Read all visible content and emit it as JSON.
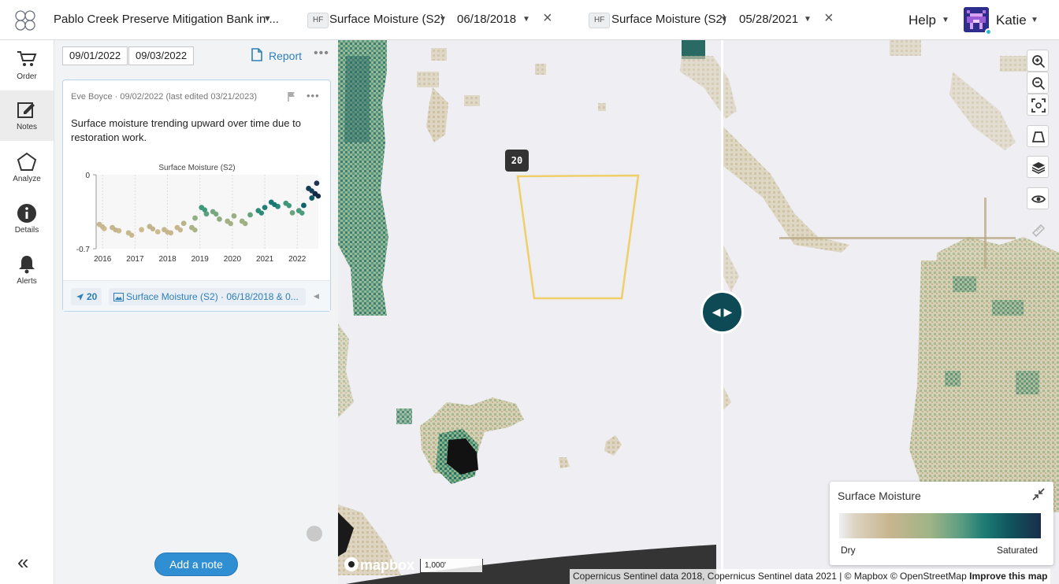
{
  "header": {
    "project": "Pablo Creek Preserve Mitigation Bank in ...",
    "left_layer": {
      "badge": "HF",
      "name": "Surface Moisture (S2)",
      "date": "06/18/2018"
    },
    "right_layer": {
      "badge": "HF",
      "name": "Surface Moisture (S2)",
      "date": "05/28/2021"
    },
    "help": "Help",
    "user": "Katie"
  },
  "rail": [
    {
      "label": "Order",
      "icon": "cart-icon"
    },
    {
      "label": "Notes",
      "icon": "notes-icon",
      "active": true
    },
    {
      "label": "Analyze",
      "icon": "pentagon-icon"
    },
    {
      "label": "Details",
      "icon": "info-icon"
    },
    {
      "label": "Alerts",
      "icon": "bell-icon"
    }
  ],
  "notes": {
    "date_from": "09/01/2022",
    "date_to": "09/03/2022",
    "report": "Report",
    "note": {
      "meta": "Eve Boyce · 09/02/2022 (last edited 03/21/2023)",
      "text": "Surface moisture trending upward over time due to restoration work.",
      "location_chip": "20",
      "layer_chip": "Surface Moisture (S2) · 06/18/2018 & 0..."
    },
    "add_note": "Add a note"
  },
  "chart_data": {
    "type": "scatter",
    "title": "Surface Moisture (S2)",
    "xlabel": "",
    "ylabel": "",
    "ylim": [
      -0.7,
      0
    ],
    "xlim": [
      2015.8,
      2022.65
    ],
    "yticks": [
      "0",
      "-0.7"
    ],
    "xticks": [
      "2016",
      "2017",
      "2018",
      "2019",
      "2020",
      "2021",
      "2022"
    ],
    "x": [
      2015.9,
      2016.05,
      2016.3,
      2016.5,
      2016.8,
      2017.2,
      2017.45,
      2017.7,
      2017.9,
      2018.1,
      2018.3,
      2018.5,
      2018.75,
      2018.85,
      2019.05,
      2019.2,
      2019.4,
      2019.6,
      2019.85,
      2020.05,
      2020.3,
      2020.55,
      2020.8,
      2021.0,
      2021.2,
      2021.4,
      2021.65,
      2021.85,
      2022.05,
      2022.2,
      2022.35,
      2022.45,
      2022.55,
      2022.6
    ],
    "y": [
      -0.47,
      -0.51,
      -0.5,
      -0.53,
      -0.55,
      -0.52,
      -0.49,
      -0.54,
      -0.52,
      -0.55,
      -0.5,
      -0.46,
      -0.5,
      -0.41,
      -0.31,
      -0.37,
      -0.35,
      -0.42,
      -0.44,
      -0.39,
      -0.44,
      -0.38,
      -0.34,
      -0.31,
      -0.26,
      -0.3,
      -0.27,
      -0.36,
      -0.34,
      -0.29,
      -0.13,
      -0.22,
      -0.18,
      -0.08
    ],
    "point_colors": [
      "#c9b88f",
      "#d2bd92",
      "#c4b58d",
      "#cbb98f",
      "#c7b88e",
      "#d0bb91",
      "#c3b38c",
      "#cfbb90",
      "#c6b68e",
      "#cab78f",
      "#c8b78e",
      "#b7b486",
      "#a9b385",
      "#8fb183",
      "#3c9a7a",
      "#5aa27e",
      "#76a881",
      "#93ad83",
      "#a6b085",
      "#98ae83",
      "#9fb085",
      "#63a37f",
      "#2c8a78",
      "#1f7e74",
      "#167870",
      "#28887a",
      "#3f977c",
      "#6aa480",
      "#4b9c7c",
      "#0f6266",
      "#133e55",
      "#0f5c66",
      "#112a45",
      "#1d3452"
    ]
  },
  "map": {
    "marker": "20",
    "swipe_icon": "swap-arrows-icon",
    "legend": {
      "title": "Surface Moisture",
      "low": "Dry",
      "high": "Saturated"
    },
    "mapbox": "mapbox",
    "scale": "1,000'",
    "attribution": "Copernicus Sentinel data 2018, Copernicus Sentinel data 2021 | © Mapbox © OpenStreetMap",
    "improve": "Improve this map"
  }
}
